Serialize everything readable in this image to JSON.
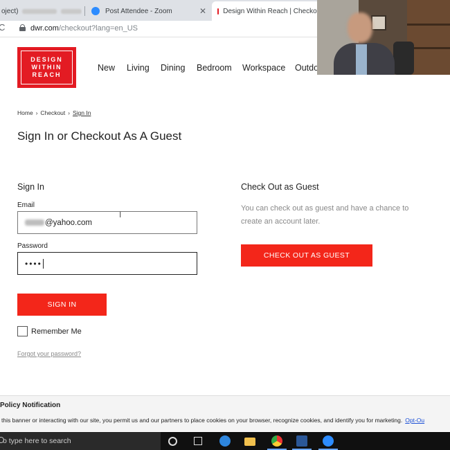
{
  "browser": {
    "tabs": [
      {
        "label": "oject)"
      },
      {
        "label": "Post Attendee - Zoom"
      },
      {
        "label": "Design Within Reach | Checkout"
      }
    ],
    "url_host": "dwr.com",
    "url_path": "/checkout?lang=en_US"
  },
  "site": {
    "logo_lines": [
      "DESIGN",
      "WITHIN",
      "REACH"
    ],
    "nav": [
      "New",
      "Living",
      "Dining",
      "Bedroom",
      "Workspace",
      "Outdo"
    ]
  },
  "breadcrumb": [
    "Home",
    "Checkout",
    "Sign In"
  ],
  "page_title": "Sign In or Checkout As A Guest",
  "signin": {
    "heading": "Sign In",
    "email_label": "Email",
    "email_visible": "@yahoo.com",
    "password_label": "Password",
    "password_masked": "••••",
    "button": "SIGN IN",
    "remember": "Remember Me",
    "forgot": "Forgot your password?"
  },
  "guest": {
    "heading": "Check Out as Guest",
    "text": "You can check out as guest and have a chance to create an account later.",
    "button": "CHECK OUT AS GUEST"
  },
  "cookie_banner": {
    "title": "Policy Notification",
    "text": "this banner or interacting with our site, you permit us and our partners to place cookies on your browser, recognize cookies, and identify you for marketing.",
    "link": "Opt-Ou"
  },
  "taskbar": {
    "search_placeholder": "o type here to search",
    "icons": [
      "cortana-icon",
      "task-view-icon",
      "edge-icon",
      "file-explorer-icon",
      "chrome-icon",
      "word-icon",
      "zoom-icon"
    ]
  },
  "colors": {
    "brand_red": "#e31b23",
    "button_red": "#f3261a"
  }
}
